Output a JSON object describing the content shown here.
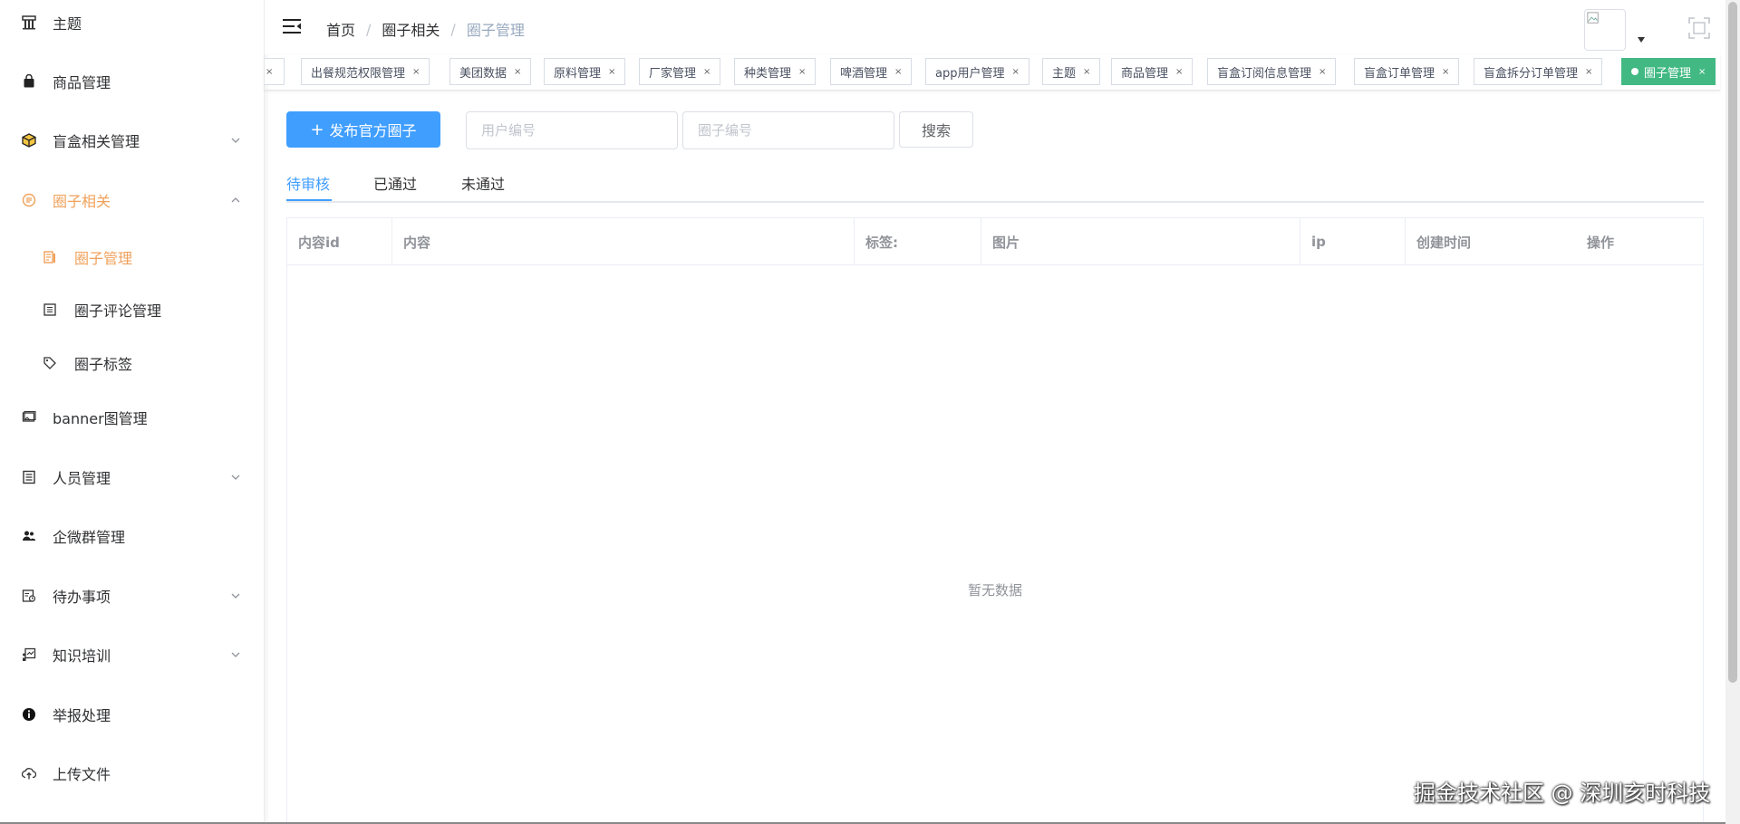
{
  "sidebar": {
    "items": [
      {
        "label": "主题",
        "icon": "theme-icon"
      },
      {
        "label": "商品管理",
        "icon": "bag-icon"
      },
      {
        "label": "盲盒相关管理",
        "icon": "box-icon"
      },
      {
        "label": "圈子相关",
        "icon": "circle-icon"
      },
      {
        "label": "banner图管理",
        "icon": "image-icon"
      },
      {
        "label": "人员管理",
        "icon": "list-icon"
      },
      {
        "label": "企微群管理",
        "icon": "people-icon"
      },
      {
        "label": "待办事项",
        "icon": "todo-icon"
      },
      {
        "label": "知识培训",
        "icon": "training-icon"
      },
      {
        "label": "举报处理",
        "icon": "info-icon"
      },
      {
        "label": "上传文件",
        "icon": "upload-icon"
      }
    ],
    "sub_items": [
      {
        "label": "圈子管理",
        "icon": "doc-icon"
      },
      {
        "label": "圈子评论管理",
        "icon": "comment-icon"
      },
      {
        "label": "圈子标签",
        "icon": "tag-icon"
      }
    ],
    "accent_color": "#f0a05a"
  },
  "breadcrumb": {
    "home": "首页",
    "parent": "圈子相关",
    "current": "圈子管理",
    "separator": "/"
  },
  "tags_view": {
    "tags": [
      "出餐规范权限管理",
      "美团数据",
      "原料管理",
      "厂家管理",
      "种类管理",
      "啤酒管理",
      "app用户管理",
      "主题",
      "商品管理",
      "盲盒订阅信息管理",
      "盲盒订单管理",
      "盲盒拆分订单管理"
    ],
    "active_tag": "圈子管理",
    "close_symbol": "×",
    "active_color": "#42b983"
  },
  "toolbar": {
    "publish_label": "发布官方圈子",
    "publish_icon": "+",
    "user_id_placeholder": "用户编号",
    "circle_id_placeholder": "圈子编号",
    "search_label": "搜索"
  },
  "tabs": [
    "待审核",
    "已通过",
    "未通过"
  ],
  "table": {
    "columns": [
      "内容id",
      "内容",
      "标签:",
      "图片",
      "ip",
      "创建时间",
      "操作"
    ],
    "empty_text": "暂无数据"
  },
  "watermark": "掘金技术社区 @ 深圳亥时科技",
  "colors": {
    "primary": "#409eff"
  }
}
